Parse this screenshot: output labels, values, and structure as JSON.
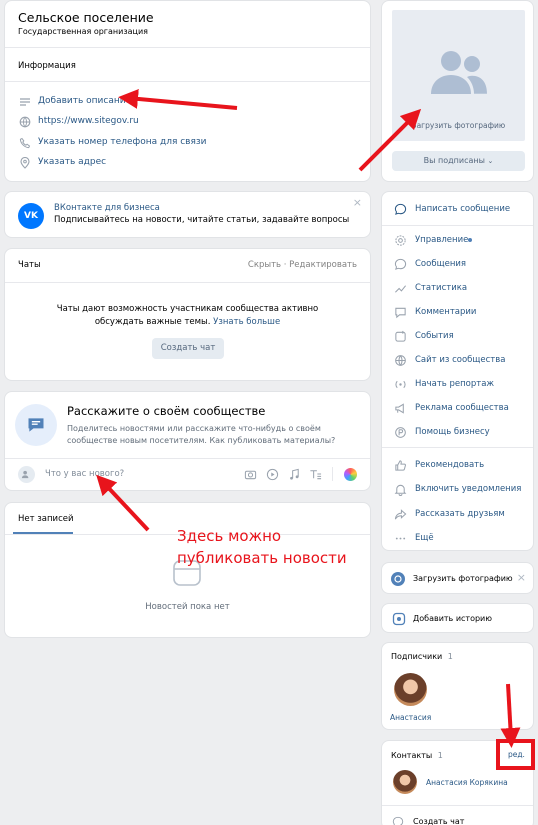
{
  "group": {
    "name": "Сельское поселение",
    "type": "Государственная организация",
    "info_header": "Информация",
    "add_description": "Добавить описание",
    "website": "https://www.sitegov.ru",
    "phone_link": "Указать номер телефона для связи",
    "address_link": "Указать адрес"
  },
  "business": {
    "title": "ВКонтакте для бизнеса",
    "subtitle": "Подписывайтесь на новости, читайте статьи, задавайте вопросы"
  },
  "chats": {
    "header": "Чаты",
    "hide": "Скрыть",
    "separator": "·",
    "edit": "Редактировать",
    "desc_line1": "Чаты дают возможность участникам сообщества активно",
    "desc_line2": "обсуждать важные темы.",
    "learn_more": "Узнать больше",
    "create_btn": "Создать чат"
  },
  "promo": {
    "title": "Расскажите о своём сообществе",
    "text_line1": "Поделитесь новостями или расскажите что-нибудь о своём",
    "text_line2": "сообществе новым посетителям.",
    "link": "Как публиковать материалы?"
  },
  "composer": {
    "placeholder": "Что у вас нового?"
  },
  "wall": {
    "tab": "Нет записей",
    "empty": "Новостей пока нет"
  },
  "annotation": {
    "line1": "Здесь можно",
    "line2": "публиковать новости",
    "color": "#e8141c"
  },
  "right": {
    "upload_photo": "Загрузить фотографию",
    "subscribed": "Вы подписаны",
    "menu_primary": "Написать сообщение",
    "menu": [
      {
        "label": "Управление",
        "icon": "gear-icon"
      },
      {
        "label": "Сообщения",
        "icon": "message-icon"
      },
      {
        "label": "Статистика",
        "icon": "chart-icon"
      },
      {
        "label": "Комментарии",
        "icon": "comment-icon"
      },
      {
        "label": "События",
        "icon": "event-icon"
      },
      {
        "label": "Сайт из сообщества",
        "icon": "globe-icon"
      },
      {
        "label": "Начать репортаж",
        "icon": "broadcast-icon"
      },
      {
        "label": "Реклама сообщества",
        "icon": "megaphone-icon"
      },
      {
        "label": "Помощь бизнесу",
        "icon": "coin-icon"
      }
    ],
    "menu2": [
      {
        "label": "Рекомендовать",
        "icon": "thumb-up-icon"
      },
      {
        "label": "Включить уведомления",
        "icon": "bell-icon"
      },
      {
        "label": "Рассказать друзьям",
        "icon": "share-icon"
      },
      {
        "label": "Ещё",
        "icon": "more-icon"
      }
    ],
    "upload_photo_card": "Загрузить фотографию",
    "add_story": "Добавить историю",
    "subscribers_title": "Подписчики",
    "subscribers_count": "1",
    "subscriber_name": "Анастасия",
    "contacts_title": "Контакты",
    "contacts_count": "1",
    "contacts_edit": "ред.",
    "contact_name": "Анастасия Корякина",
    "create_chat": "Создать чат"
  }
}
